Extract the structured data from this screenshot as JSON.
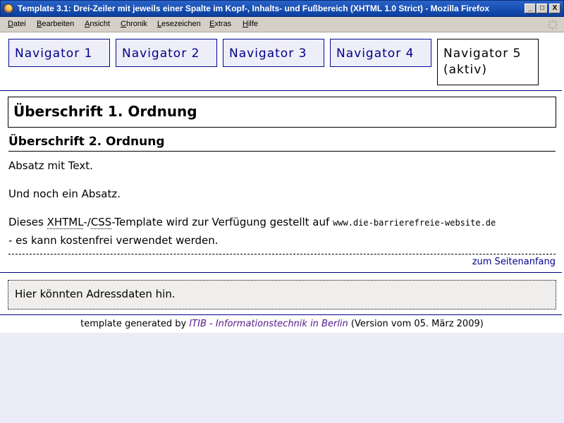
{
  "window": {
    "title": "Template 3.1: Drei-Zeiler mit jeweils einer Spalte im Kopf-, Inhalts- und Fußbereich (XHTML 1.0 Strict) - Mozilla Firefox",
    "controls": {
      "minimize": "_",
      "maximize": "□",
      "close": "X"
    }
  },
  "menu": {
    "items": [
      "Datei",
      "Bearbeiten",
      "Ansicht",
      "Chronik",
      "Lesezeichen",
      "Extras",
      "Hilfe"
    ]
  },
  "nav": {
    "items": [
      "Navigator 1",
      "Navigator 2",
      "Navigator 3",
      "Navigator 4"
    ],
    "active_line1": "Navigator 5",
    "active_line2": "(aktiv)"
  },
  "content": {
    "h1": "Überschrift 1. Ordnung",
    "h2": "Überschrift 2. Ordnung",
    "p1": "Absatz mit Text.",
    "p2": "Und noch ein Absatz.",
    "p3_before": "Dieses ",
    "abbr1": "XHTML",
    "p3_sep": "-/",
    "abbr2": "CSS",
    "p3_after": "-Template wird zur Verfügung gestellt auf ",
    "url": "www.die-barrierefreie-website.de",
    "p3_line2": "- es kann kostenfrei verwendet werden.",
    "top_link": "zum Seitenanfang"
  },
  "footer": {
    "address": "Hier könnten Adressdaten hin.",
    "credits_prefix": "template generated by ",
    "credits_link": "ITIB - Informationstechnik in Berlin",
    "credits_suffix": " (Version vom 05. März 2009)"
  }
}
